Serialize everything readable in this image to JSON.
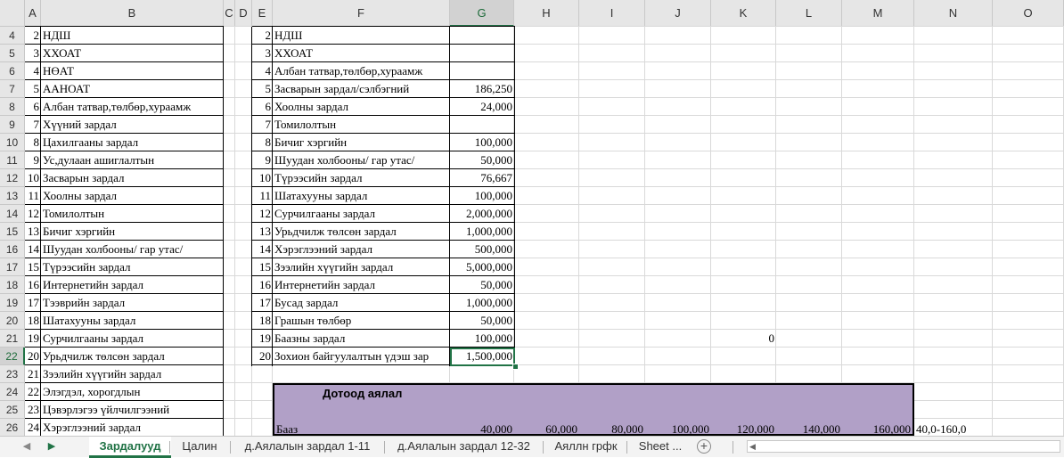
{
  "sheet": {
    "columns": [
      "A",
      "B",
      "C",
      "D",
      "E",
      "F",
      "G",
      "H",
      "I",
      "J",
      "K",
      "L",
      "M",
      "N",
      "O"
    ],
    "selected_column": "G",
    "selected_row": "22",
    "rows": [
      {
        "r": "4",
        "a": "2",
        "b": "НДШ",
        "e": "2",
        "f": "НДШ",
        "g": ""
      },
      {
        "r": "5",
        "a": "3",
        "b": "ХХОАТ",
        "e": "3",
        "f": "ХХОАТ",
        "g": ""
      },
      {
        "r": "6",
        "a": "4",
        "b": "НӨАТ",
        "e": "4",
        "f": "Албан татвар,төлбөр,хураамж",
        "g": ""
      },
      {
        "r": "7",
        "a": "5",
        "b": "ААНОАТ",
        "e": "5",
        "f": "Засварын зардал/сэлбэгний",
        "g": "186,250"
      },
      {
        "r": "8",
        "a": "6",
        "b": "Албан татвар,төлбөр,хураамж",
        "e": "6",
        "f": "Хоолны зардал",
        "g": "24,000"
      },
      {
        "r": "9",
        "a": "7",
        "b": "Хүүний зардал",
        "e": "7",
        "f": "Томилолтын",
        "g": ""
      },
      {
        "r": "10",
        "a": "8",
        "b": "Цахилгааны зардал",
        "e": "8",
        "f": "Бичиг хэргийн",
        "g": "100,000"
      },
      {
        "r": "11",
        "a": "9",
        "b": "Ус,дулаан ашиглалтын",
        "e": "9",
        "f": "Шуудан холбооны/ гар утас/",
        "g": "50,000"
      },
      {
        "r": "12",
        "a": "10",
        "b": "Засварын зардал",
        "e": "10",
        "f": "Түрээсийн зардал",
        "g": "76,667"
      },
      {
        "r": "13",
        "a": "11",
        "b": "Хоолны зардал",
        "e": "11",
        "f": "Шатахууны зардал",
        "g": "100,000"
      },
      {
        "r": "14",
        "a": "12",
        "b": "Томилолтын",
        "e": "12",
        "f": "Сурчилгааны зардал",
        "g": "2,000,000"
      },
      {
        "r": "15",
        "a": "13",
        "b": "Бичиг хэргийн",
        "e": "13",
        "f": "Урьдчилж төлсөн зардал",
        "g": "1,000,000"
      },
      {
        "r": "16",
        "a": "14",
        "b": "Шуудан холбооны/ гар утас/",
        "e": "14",
        "f": "Хэрэглээний зардал",
        "g": "500,000"
      },
      {
        "r": "17",
        "a": "15",
        "b": "Түрээсийн зардал",
        "e": "15",
        "f": "Зээлийн хүүгийн зардал",
        "g": "5,000,000"
      },
      {
        "r": "18",
        "a": "16",
        "b": "Интернетийн зардал",
        "e": "16",
        "f": "Интернетийн зардал",
        "g": "50,000"
      },
      {
        "r": "19",
        "a": "17",
        "b": "Тээврийн зардал",
        "e": "17",
        "f": "Бусад зардал",
        "g": "1,000,000"
      },
      {
        "r": "20",
        "a": "18",
        "b": "Шатахууны зардал",
        "e": "18",
        "f": "Грашын төлбөр",
        "g": "50,000"
      },
      {
        "r": "21",
        "a": "19",
        "b": "Сурчилгааны зардал",
        "e": "19",
        "f": "Баазны зардал",
        "g": "100,000",
        "k": "0"
      },
      {
        "r": "22",
        "a": "20",
        "b": "Урьдчилж төлсөн зардал",
        "e": "20",
        "f": "Зохион байгуулалтын үдэш зар",
        "g": "1,500,000"
      },
      {
        "r": "23",
        "a": "21",
        "b": "Зээлийн хүүгийн зардал"
      },
      {
        "r": "24",
        "a": "22",
        "b": "Элэгдэл, хорогдлын"
      },
      {
        "r": "25",
        "a": "23",
        "b": "Цэвэрлэгээ үйлчилгээний"
      },
      {
        "r": "26",
        "a": "24",
        "b": "Хэрэглээний зардал"
      }
    ],
    "table_title": "Дотоод аялал",
    "base_row": {
      "label": "Бааз",
      "values": [
        "40,000",
        "60,000",
        "80,000",
        "100,000",
        "120,000",
        "140,000",
        "160,000"
      ],
      "range_label": "40,0-160,0"
    }
  },
  "tabs": [
    {
      "label": "Зардалууд",
      "active": true
    },
    {
      "label": "Цалин",
      "active": false
    },
    {
      "label": "д.Аялалын зардал 1-11",
      "active": false
    },
    {
      "label": "д.Аялалын зардал 12-32",
      "active": false
    },
    {
      "label": "Аяллн грфк",
      "active": false
    },
    {
      "label": "Sheet ...",
      "active": false
    }
  ],
  "nav": {
    "prev": "◀",
    "next": "▶",
    "add": "+",
    "scroll_left": "◀"
  }
}
